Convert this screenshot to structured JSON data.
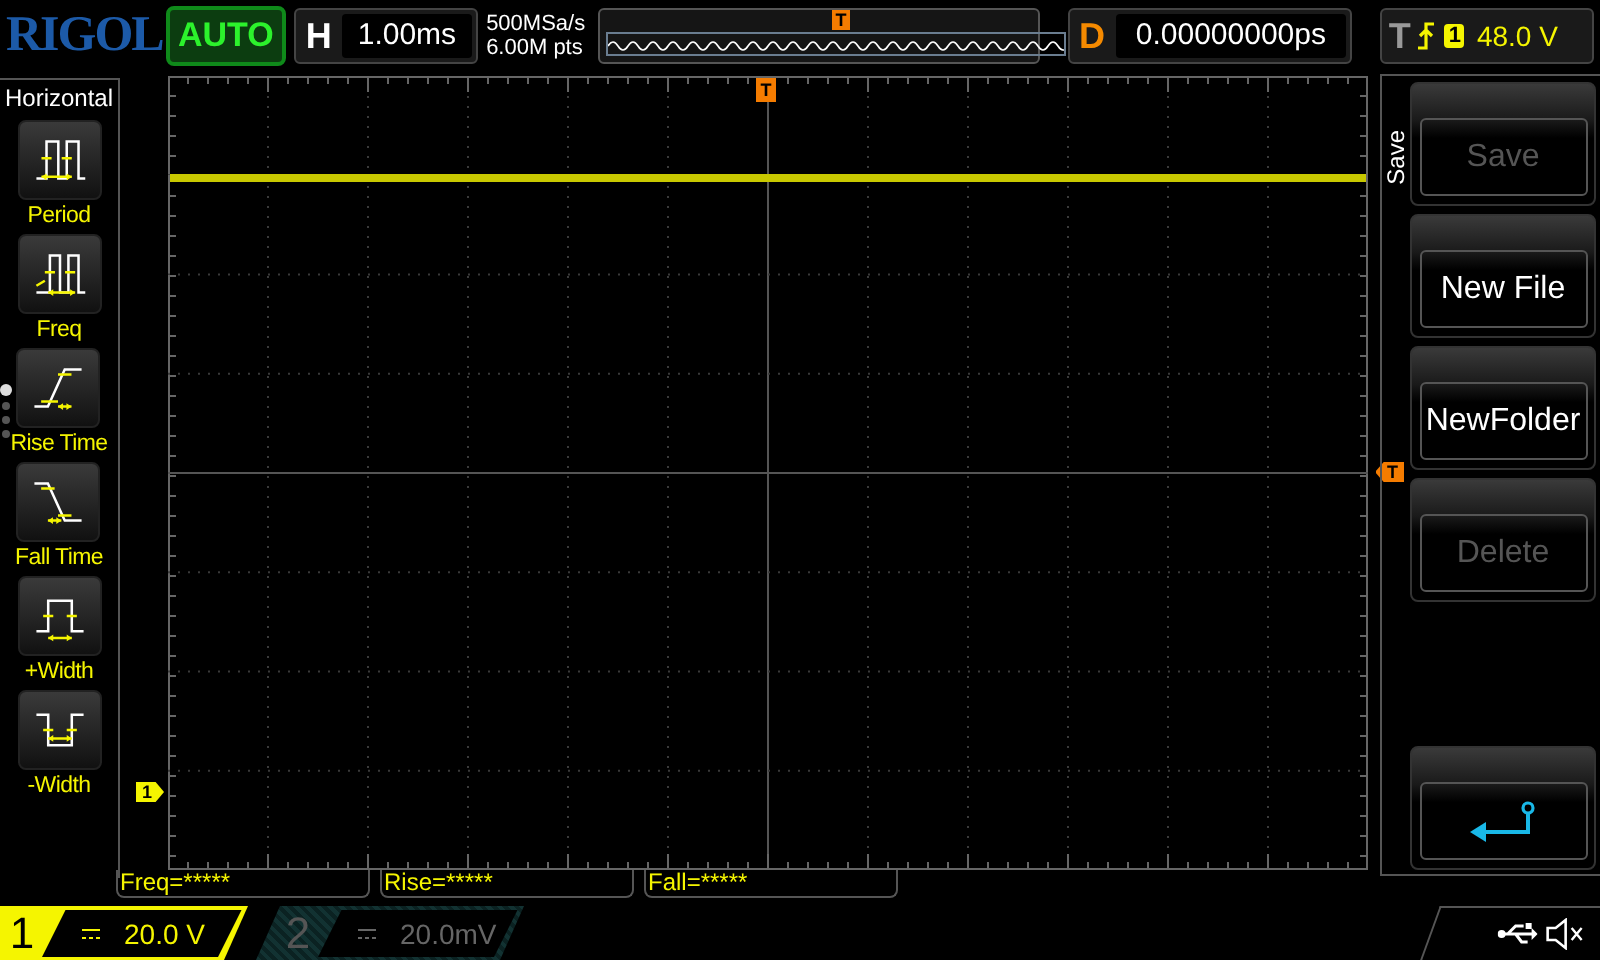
{
  "logo": "RIGOL",
  "run_status": {
    "label": "AUTO"
  },
  "timebase": {
    "label": "H",
    "value": "1.00ms"
  },
  "acquisition": {
    "sample_rate": "500MSa/s",
    "memory_depth": "6.00M pts"
  },
  "overview": {
    "trigger_marker": "T"
  },
  "delay": {
    "label": "D",
    "value": "0.00000000ps"
  },
  "trigger": {
    "label": "T",
    "source": "1",
    "value": "48.0 V"
  },
  "left_menu": {
    "title": "Horizontal",
    "pages": [
      {
        "selected": true
      },
      {
        "selected": false
      },
      {
        "selected": false
      },
      {
        "selected": false
      }
    ],
    "items": [
      {
        "kind": "period",
        "label": "Period"
      },
      {
        "kind": "freq",
        "label": "Freq"
      },
      {
        "kind": "rise",
        "label": "Rise Time"
      },
      {
        "kind": "fall",
        "label": "Fall Time"
      },
      {
        "kind": "pwidth",
        "label": "+Width"
      },
      {
        "kind": "nwidth",
        "label": "-Width"
      }
    ]
  },
  "grid": {
    "channel_marker": "1",
    "trigger_marker_top": "T",
    "trigger_marker_right": "T"
  },
  "soft_menu": {
    "title": "Save",
    "items": [
      {
        "kind": "text",
        "label": "Save",
        "disabled": true
      },
      {
        "kind": "text",
        "label": "New File",
        "disabled": false
      },
      {
        "kind": "text",
        "label": "NewFolder",
        "disabled": false
      },
      {
        "kind": "text",
        "label": "Delete",
        "disabled": true
      },
      {
        "kind": "return"
      }
    ]
  },
  "measurements": [
    {
      "text": "Freq=*****"
    },
    {
      "text": "Rise=*****"
    },
    {
      "text": "Fall=*****"
    }
  ],
  "channels": [
    {
      "number": "1",
      "value": "20.0 V",
      "active": true
    },
    {
      "number": "2",
      "value": "20.0mV",
      "active": false
    }
  ]
}
